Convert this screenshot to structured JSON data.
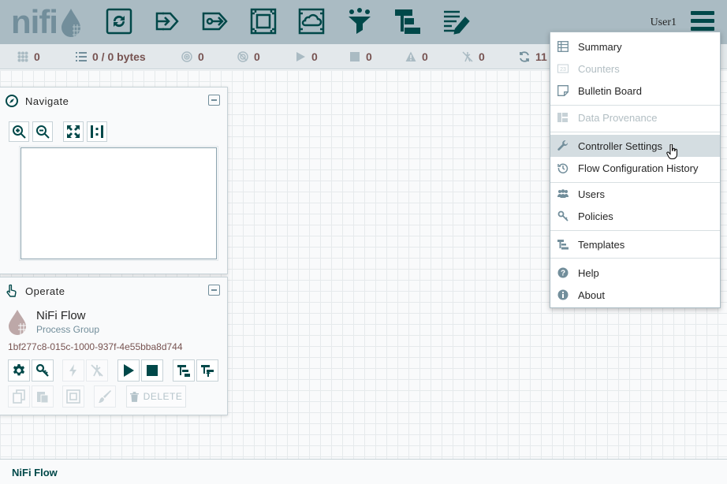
{
  "header": {
    "logo_text": "nifi",
    "user": "User1",
    "toolbar": [
      "processor-icon",
      "input-port-icon",
      "output-port-icon",
      "process-group-icon",
      "remote-process-group-icon",
      "funnel-icon",
      "template-icon",
      "label-icon"
    ]
  },
  "status": {
    "thread_count": "0",
    "queued": "0 / 0 bytes",
    "transmitting": "0",
    "not_transmitting": "0",
    "running": "0",
    "stopped": "0",
    "invalid": "0",
    "disabled": "0",
    "refresh": "11"
  },
  "navigate": {
    "title": "Navigate"
  },
  "operate": {
    "title": "Operate",
    "name": "NiFi Flow",
    "type": "Process Group",
    "id": "1bf277c8-015c-1000-937f-4e55bba8d744",
    "delete_label": "DELETE"
  },
  "footer": {
    "breadcrumb": "NiFi Flow"
  },
  "menu": {
    "items": [
      {
        "label": "Summary",
        "icon": "table-icon",
        "disabled": false
      },
      {
        "label": "Counters",
        "icon": "counter-icon",
        "disabled": true
      },
      {
        "label": "Bulletin Board",
        "icon": "sticky-note-icon",
        "disabled": false
      },
      {
        "label": "Data Provenance",
        "icon": "provenance-icon",
        "disabled": true
      },
      {
        "label": "Controller Settings",
        "icon": "wrench-icon",
        "disabled": false,
        "hovered": true
      },
      {
        "label": "Flow Configuration History",
        "icon": "history-icon",
        "disabled": false
      },
      {
        "label": "Users",
        "icon": "users-icon",
        "disabled": false
      },
      {
        "label": "Policies",
        "icon": "key-icon",
        "disabled": false
      },
      {
        "label": "Templates",
        "icon": "templates-icon",
        "disabled": false
      },
      {
        "label": "Help",
        "icon": "help-icon",
        "disabled": false
      },
      {
        "label": "About",
        "icon": "info-icon",
        "disabled": false
      }
    ]
  },
  "colors": {
    "header_bg": "#aabbc3",
    "accent": "#004849",
    "status_text": "#775351",
    "muted": "#728e9b"
  }
}
